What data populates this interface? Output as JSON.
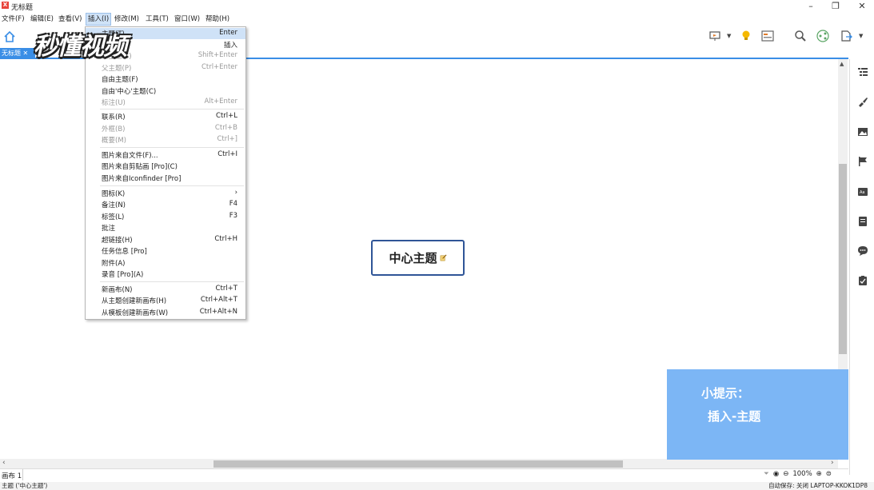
{
  "window": {
    "title": "无标题",
    "logo_text": "X"
  },
  "menubar": [
    {
      "label": "文件(F)"
    },
    {
      "label": "编辑(E)"
    },
    {
      "label": "查看(V)"
    },
    {
      "label": "插入(I)"
    },
    {
      "label": "修改(M)"
    },
    {
      "label": "工具(T)"
    },
    {
      "label": "窗口(W)"
    },
    {
      "label": "帮助(H)"
    }
  ],
  "tab": {
    "label": "无标题"
  },
  "insert_menu": {
    "items": [
      {
        "label": "主题(T)",
        "shortcut": "Enter",
        "disabled": false,
        "highlight": true
      },
      {
        "label": "",
        "shortcut": "插入",
        "disabled": false
      },
      {
        "label": "子主题(S)",
        "shortcut": "Shift+Enter",
        "disabled": true
      },
      {
        "label": "父主题(P)",
        "shortcut": "Ctrl+Enter",
        "disabled": true
      },
      {
        "label": "自由主题(F)",
        "shortcut": "",
        "disabled": false
      },
      {
        "label": "自由'中心'主题(C)",
        "shortcut": "",
        "disabled": false
      },
      {
        "label": "标注(U)",
        "shortcut": "Alt+Enter",
        "disabled": true
      },
      {
        "label": "联系(R)",
        "shortcut": "Ctrl+L",
        "disabled": false
      },
      {
        "label": "外框(B)",
        "shortcut": "Ctrl+B",
        "disabled": true
      },
      {
        "label": "概要(M)",
        "shortcut": "Ctrl+]",
        "disabled": true
      },
      {
        "label": "图片来自文件(F)...",
        "shortcut": "Ctrl+I",
        "disabled": false
      },
      {
        "label": "图片来自剪贴画 [Pro](C)",
        "shortcut": "",
        "disabled": false
      },
      {
        "label": "图片来自Iconfinder [Pro]",
        "shortcut": "",
        "disabled": false
      },
      {
        "label": "图标(K)",
        "shortcut": "›",
        "disabled": false
      },
      {
        "label": "备注(N)",
        "shortcut": "F4",
        "disabled": false
      },
      {
        "label": "标签(L)",
        "shortcut": "F3",
        "disabled": false
      },
      {
        "label": "批注",
        "shortcut": "",
        "disabled": false
      },
      {
        "label": "超链接(H)",
        "shortcut": "Ctrl+H",
        "disabled": false
      },
      {
        "label": "任务信息 [Pro]",
        "shortcut": "",
        "disabled": false
      },
      {
        "label": "附件(A)",
        "shortcut": "",
        "disabled": false
      },
      {
        "label": "录音 [Pro](A)",
        "shortcut": "",
        "disabled": false
      },
      {
        "label": "新画布(N)",
        "shortcut": "Ctrl+T",
        "disabled": false
      },
      {
        "label": "从主题创建新画布(H)",
        "shortcut": "Ctrl+Alt+T",
        "disabled": false
      },
      {
        "label": "从模板创建新画布(W)",
        "shortcut": "Ctrl+Alt+N",
        "disabled": false
      }
    ]
  },
  "canvas": {
    "central_topic": "中心主题"
  },
  "watermark": "秒懂视频",
  "tip": {
    "title": "小提示：",
    "body": "插入-主题"
  },
  "bottom": {
    "sheet": "画布 1",
    "zoom": "100%"
  },
  "status": {
    "left": "主题 ('中心主题')",
    "right": "自动保存: 关闭   LAPTOP-KKOK1DP8"
  },
  "colors": {
    "accent": "#3a8ee6",
    "topic_border": "#2f5597",
    "tip_bg": "#7cb6f5"
  }
}
